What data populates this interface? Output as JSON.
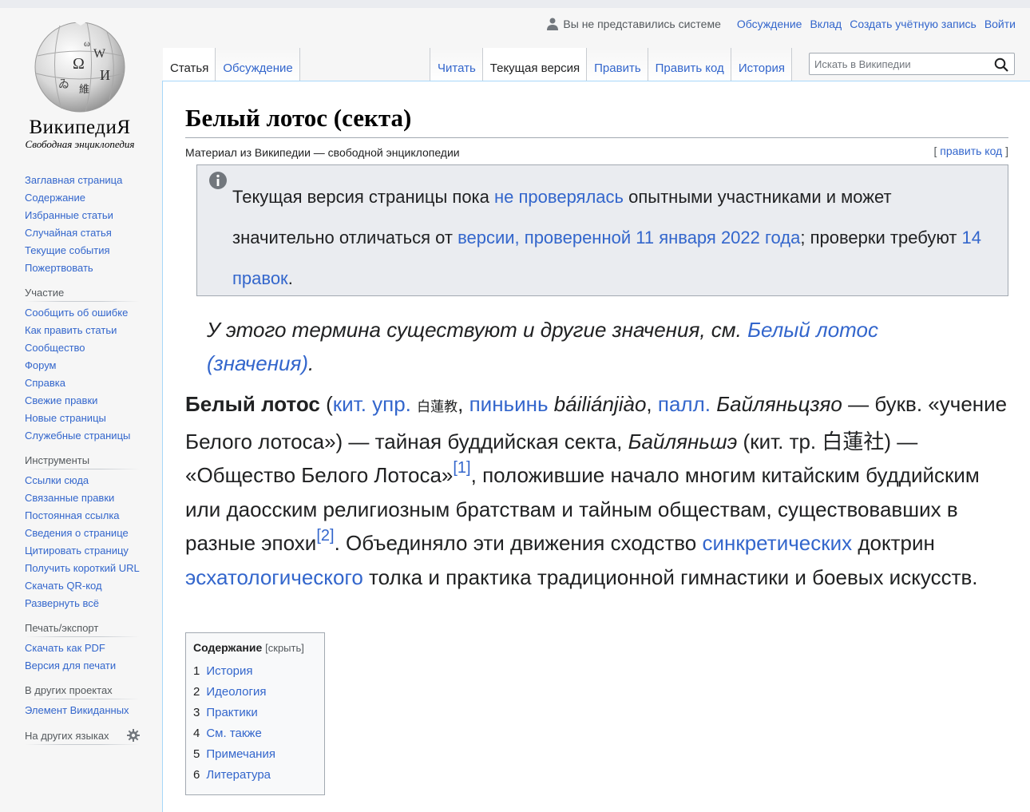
{
  "logo": {
    "wordmark": "ВикипедиЯ",
    "tagline": "Свободная энциклопедия"
  },
  "personal": {
    "anon": "Вы не представились системе",
    "links": [
      "Обсуждение",
      "Вклад",
      "Создать учётную запись",
      "Войти"
    ]
  },
  "tabs": {
    "left": [
      "Статья",
      "Обсуждение"
    ],
    "right": [
      "Читать",
      "Текущая версия",
      "Править",
      "Править код",
      "История"
    ]
  },
  "search": {
    "placeholder": "Искать в Википедии"
  },
  "sidebar": {
    "nav": [
      "Заглавная страница",
      "Содержание",
      "Избранные статьи",
      "Случайная статья",
      "Текущие события",
      "Пожертвовать"
    ],
    "participation": {
      "heading": "Участие",
      "items": [
        "Сообщить об ошибке",
        "Как править статьи",
        "Сообщество",
        "Форум",
        "Справка",
        "Свежие правки",
        "Новые страницы",
        "Служебные страницы"
      ]
    },
    "tools": {
      "heading": "Инструменты",
      "items": [
        "Ссылки сюда",
        "Связанные правки",
        "Постоянная ссылка",
        "Сведения о странице",
        "Цитировать страницу",
        "Получить короткий URL",
        "Скачать QR-код",
        "Развернуть всё"
      ]
    },
    "print": {
      "heading": "Печать/экспорт",
      "items": [
        "Скачать как PDF",
        "Версия для печати"
      ]
    },
    "projects": {
      "heading": "В других проектах",
      "items": [
        "Элемент Викиданных"
      ]
    },
    "languages": {
      "heading": "На других языках"
    }
  },
  "article": {
    "title": "Белый лотос (секта)",
    "tagline": "Материал из Википедии — свободной энциклопедии",
    "edit_open": "[ ",
    "edit_label": "править код",
    "edit_close": " ]",
    "notice": {
      "t1": "Текущая версия страницы пока ",
      "l1": "не проверялась",
      "t2": " опытными участниками и может значительно отличаться от ",
      "l2": "версии, проверенной 11 января 2022 года",
      "t3": "; проверки требуют ",
      "l3": "14 правок",
      "t4": "."
    },
    "hatnote": {
      "t1": "У этого термина существуют и другие значения, см. ",
      "l1": "Белый лотос (значения)",
      "t2": "."
    },
    "lead": {
      "bold": "Белый лотос",
      "t1": " (",
      "l1": "кит. упр.",
      "t2": " ",
      "cjk1": "白蓮教",
      "t3": ", ",
      "l2": "пиньинь",
      "t4": " ",
      "pinyin": "báiliánjiào",
      "t5": ", ",
      "l3": "палл.",
      "t6": " ",
      "pall": "Байляньцзяо",
      "t7": " — букв. «учение Белого лотоса») — тайная буддийская секта, ",
      "alt": "Байляньшэ",
      "t8": " (кит. тр. 白蓮社) — «Общество Белого Лотоса»",
      "ref1": "[1]",
      "t9": ", положившие начало многим китайским буддийским или даосским религиозным братствам и тайным обществам, существовавших в разные эпохи",
      "ref2": "[2]",
      "t10": ". Объединяло эти движения сходство ",
      "l4": "синкретических",
      "t11": " доктрин ",
      "l5": "эсхатологического",
      "t12": " толка и практика традиционной гимнастики и боевых искусств."
    },
    "toc": {
      "title": "Содержание",
      "hide": "[скрыть]",
      "items": [
        {
          "num": "1",
          "label": "История"
        },
        {
          "num": "2",
          "label": "Идеология"
        },
        {
          "num": "3",
          "label": "Практики"
        },
        {
          "num": "4",
          "label": "См. также"
        },
        {
          "num": "5",
          "label": "Примечания"
        },
        {
          "num": "6",
          "label": "Литература"
        }
      ]
    }
  }
}
